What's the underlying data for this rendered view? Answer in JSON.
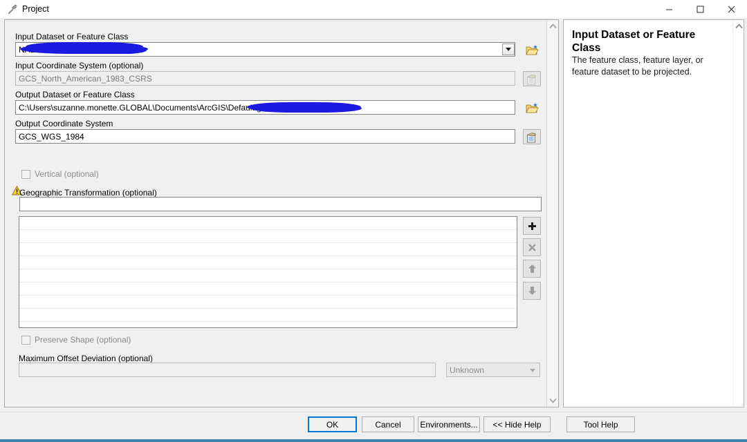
{
  "window": {
    "title": "Project",
    "icon": "hammer-tool-icon",
    "controls": {
      "minimize": "–",
      "maximize": "☐",
      "close": "✕"
    }
  },
  "form": {
    "input_dataset": {
      "label": "Input Dataset or Feature Class",
      "value": "NAD83CSRS98",
      "redacted": true,
      "browse_icon": "open-folder-icon",
      "dropdown_icon": "chevron-down-icon"
    },
    "input_coordinate_system": {
      "label": "Input Coordinate System (optional)",
      "value": "GCS_North_American_1983_CSRS",
      "disabled": true,
      "picker_icon": "spatial-reference-icon"
    },
    "output_dataset": {
      "label": "Output Dataset or Feature Class",
      "value": "C:\\Users\\suzanne.monette.GLOBAL\\Documents\\ArcGIS\\Default.gdb\\",
      "redacted": true,
      "browse_icon": "open-folder-icon"
    },
    "output_coordinate_system": {
      "label": "Output Coordinate System",
      "value": "GCS_WGS_1984",
      "picker_icon": "spatial-reference-icon"
    },
    "vertical": {
      "label": "Vertical (optional)",
      "checked": false,
      "disabled": true
    },
    "geographic_transformation": {
      "label": "Geographic Transformation (optional)",
      "value": "",
      "warning_icon": "warning-triangle-icon",
      "has_warning": true
    },
    "transformation_list": {
      "rows": [
        "",
        "",
        "",
        "",
        "",
        "",
        "",
        ""
      ],
      "tools": [
        {
          "name": "add-button",
          "glyph": "✚",
          "enabled": true
        },
        {
          "name": "delete-button",
          "glyph": "✕",
          "enabled": false
        },
        {
          "name": "move-up-button",
          "glyph": "↑",
          "enabled": false
        },
        {
          "name": "move-down-button",
          "glyph": "↓",
          "enabled": false
        }
      ]
    },
    "preserve_shape": {
      "label": "Preserve Shape (optional)",
      "checked": false,
      "disabled": true
    },
    "maximum_offset_deviation": {
      "label": "Maximum Offset Deviation (optional)",
      "value": "",
      "unit": "Unknown",
      "disabled": true
    }
  },
  "help": {
    "title": "Input Dataset or Feature Class",
    "text": "The feature class, feature layer, or feature dataset to be projected."
  },
  "buttons": {
    "ok": "OK",
    "cancel": "Cancel",
    "environments": "Environments...",
    "hide_help": "<< Hide Help",
    "tool_help": "Tool Help"
  },
  "colors": {
    "accent": "#0078d7",
    "redaction": "#1a1ae0",
    "warning": "#ffd21f",
    "bottom_accent": "#3a83ad",
    "dialog_bg": "#f0f0f0"
  }
}
